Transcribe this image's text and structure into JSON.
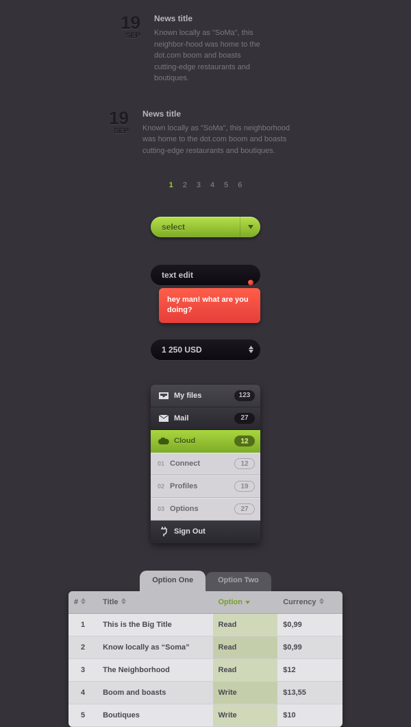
{
  "news": [
    {
      "day": "19",
      "month": "SEP",
      "title": "News title",
      "body": "Known locally as \"SoMa\", this neighbor-hood was home to the dot.com boom and boasts cutting-edge restaurants and boutiques."
    },
    {
      "day": "19",
      "month": "SEP",
      "title": "News title",
      "body": "Known locally as \"SoMa\", this neighborhood was home to the dot.com boom and boasts cutting-edge restaurants and boutiques."
    }
  ],
  "pagination": {
    "pages": [
      "1",
      "2",
      "3",
      "4",
      "5",
      "6"
    ],
    "active": "1"
  },
  "select": {
    "label": "select"
  },
  "text_edit": {
    "label": "text edit"
  },
  "tooltip": {
    "text": "hey man! what are you doing?"
  },
  "spinner": {
    "value": "1 250 USD"
  },
  "menu": {
    "items": [
      {
        "icon": "inbox",
        "label": "My files",
        "badge": "123",
        "style": "dark1"
      },
      {
        "icon": "mail",
        "label": "Mail",
        "badge": "27",
        "style": "dark2"
      },
      {
        "icon": "cloud",
        "label": "Cloud",
        "badge": "12",
        "style": "green"
      },
      {
        "num": "01",
        "label": "Connect",
        "badge": "12",
        "style": "light"
      },
      {
        "num": "02",
        "label": "Profiles",
        "badge": "19",
        "style": "light"
      },
      {
        "num": "03",
        "label": "Options",
        "badge": "27",
        "style": "light"
      }
    ],
    "signout": "Sign Out"
  },
  "tabs": {
    "active": "Option One",
    "inactive": "Option Two"
  },
  "table": {
    "headers": {
      "num": "#",
      "title": "Title",
      "option": "Option",
      "currency": "Currency"
    },
    "rows": [
      {
        "num": "1",
        "title": "This is the Big Title",
        "option": "Read",
        "currency": "$0,99"
      },
      {
        "num": "2",
        "title": "Know locally as “Soma”",
        "option": "Read",
        "currency": "$0,99"
      },
      {
        "num": "3",
        "title": "The Neighborhood",
        "option": "Read",
        "currency": "$12"
      },
      {
        "num": "4",
        "title": "Boom and boasts",
        "option": "Write",
        "currency": "$13,55"
      },
      {
        "num": "5",
        "title": "Boutiques",
        "option": "Write",
        "currency": "$10"
      }
    ]
  }
}
